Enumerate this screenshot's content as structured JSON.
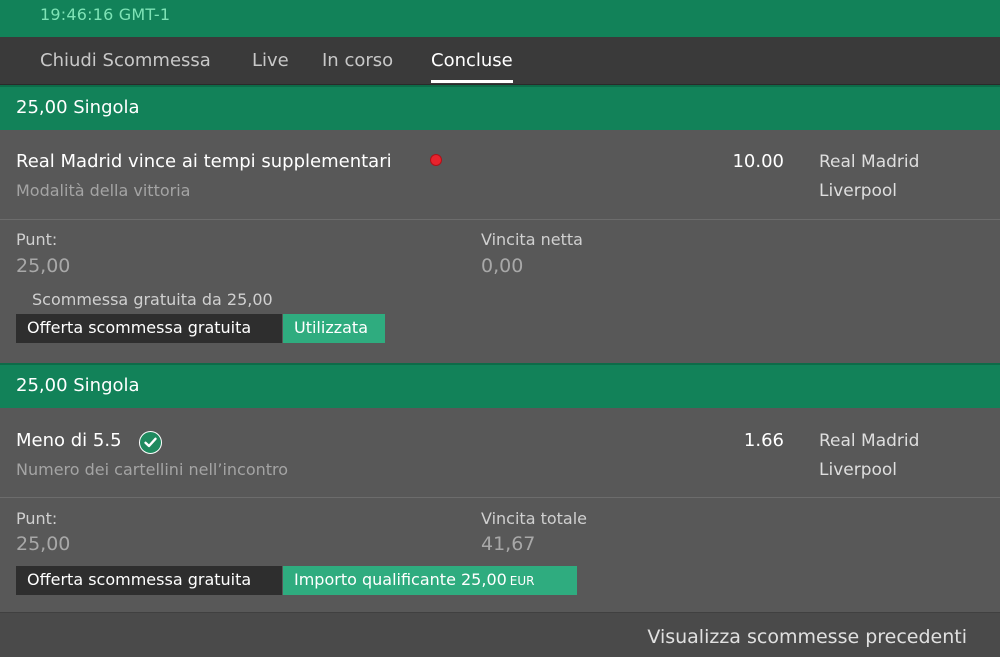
{
  "header": {
    "clock": "19:46:16 GMT-1"
  },
  "tabs": [
    {
      "label": "Chiudi Scommessa",
      "active": false
    },
    {
      "label": "Live",
      "active": false
    },
    {
      "label": "In corso",
      "active": false
    },
    {
      "label": "Concluse",
      "active": true
    }
  ],
  "bets": [
    {
      "header": "25,00 Singola",
      "selection": "Real Madrid vince ai tempi supplementari",
      "market": "Modalità della vittoria",
      "odds": "10.00",
      "teams": [
        "Real Madrid",
        "Liverpool"
      ],
      "status": "lost",
      "stake_label": "Punt:",
      "stake_value": "25,00",
      "return_label": "Vincita netta",
      "return_value": "0,00",
      "free_bet_note": "Scommessa gratuita da 25,00",
      "offer_label": "Offerta scommessa gratuita",
      "offer_status": "Utilizzata"
    },
    {
      "header": "25,00 Singola",
      "selection": "Meno di 5.5",
      "market": "Numero dei cartellini nell’incontro",
      "odds": "1.66",
      "teams": [
        "Real Madrid",
        "Liverpool"
      ],
      "status": "won",
      "stake_label": "Punt:",
      "stake_value": "25,00",
      "return_label": "Vincita totale",
      "return_value": "41,67",
      "offer_label": "Offerta scommessa gratuita",
      "offer_status": "Importo qualificante 25,00",
      "offer_currency": "EUR"
    }
  ],
  "footer": {
    "link": "Visualizza scommesse precedenti"
  },
  "colors": {
    "brand_green": "#128259",
    "accent_green": "#2fac7f",
    "lost_red": "#e8232d"
  }
}
